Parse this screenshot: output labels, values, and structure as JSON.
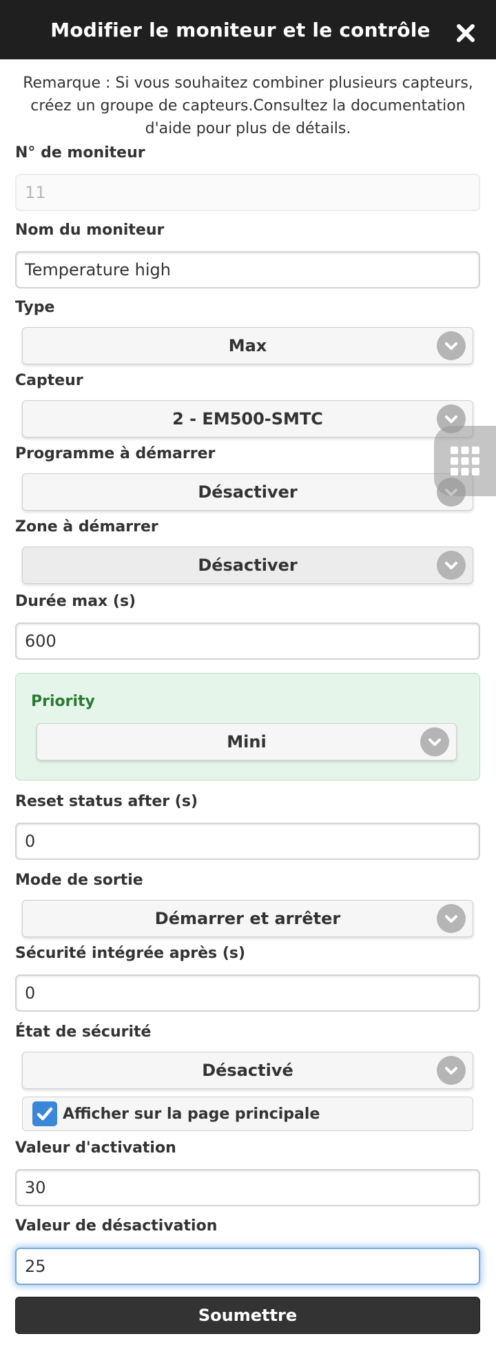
{
  "dialog": {
    "title": "Modifier le moniteur et le contrôle",
    "close_icon": "close-icon"
  },
  "note": "Remarque : Si vous souhaitez combiner plusieurs capteurs, créez un groupe de capteurs.Consultez la documentation d'aide pour plus de détails.",
  "fields": {
    "monitor_number": {
      "label": "N° de moniteur",
      "value": "11"
    },
    "monitor_name": {
      "label": "Nom du moniteur",
      "value": "Temperature high"
    },
    "type": {
      "label": "Type",
      "value": "Max"
    },
    "sensor": {
      "label": "Capteur",
      "value": "2 - EM500-SMTC"
    },
    "program": {
      "label": "Programme à démarrer",
      "value": "Désactiver"
    },
    "zone": {
      "label": "Zone à démarrer",
      "value": "Désactiver"
    },
    "max_duration": {
      "label": "Durée max (s)",
      "value": "600"
    },
    "priority": {
      "label": "Priority",
      "value": "Mini"
    },
    "reset_status": {
      "label": "Reset status after (s)",
      "value": "0"
    },
    "output_mode": {
      "label": "Mode de sortie",
      "value": "Démarrer et arrêter"
    },
    "failsafe_after": {
      "label": "Sécurité intégrée après (s)",
      "value": "0"
    },
    "safety_state": {
      "label": "État de sécurité",
      "value": "Désactivé"
    },
    "show_main_page": {
      "label": "Afficher sur la page principale",
      "checked": true
    },
    "activation_value": {
      "label": "Valeur d'activation",
      "value": "30"
    },
    "deactivation_value": {
      "label": "Valeur de désactivation",
      "value": "25"
    }
  },
  "submit_label": "Soumettre",
  "colors": {
    "header_bg": "#1f1f1f",
    "priority_bg": "#e6f5e9",
    "priority_text": "#2b7a33",
    "checkbox": "#3a87d9",
    "submit_bg": "#333333",
    "focus_glow": "#5096e6"
  },
  "icons": {
    "chevron": "chevron-down-icon",
    "grid": "grid-menu-icon",
    "check": "check-icon"
  }
}
